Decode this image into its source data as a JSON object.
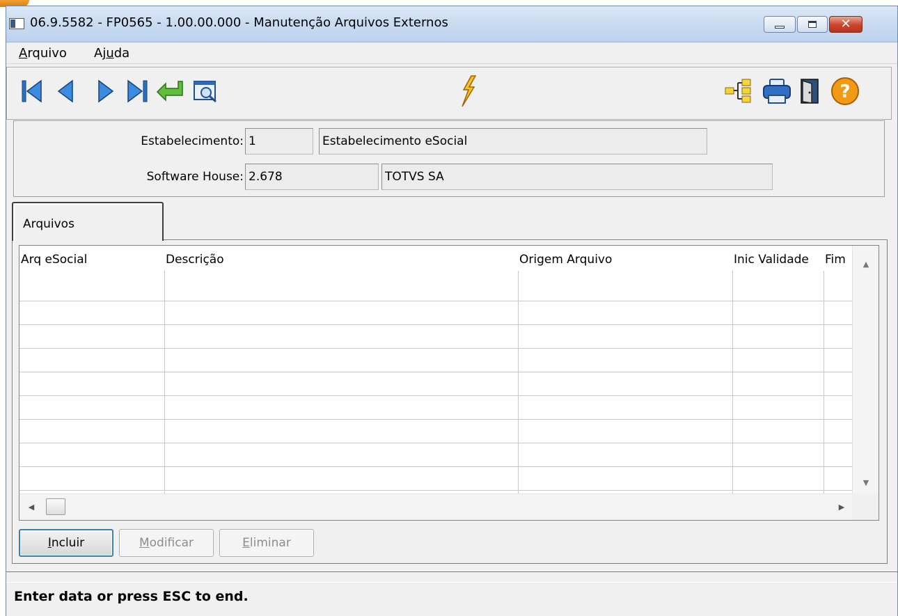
{
  "window": {
    "title": "06.9.5582 - FP0565 - 1.00.00.000 - Manutenção Arquivos Externos",
    "minimize_icon": "minimize-icon",
    "maximize_icon": "maximize-icon",
    "close_icon": "close-icon"
  },
  "menu": {
    "items": [
      {
        "label": "Arquivo",
        "accesskey": "A"
      },
      {
        "label": "Ajuda",
        "accesskey": "u"
      }
    ]
  },
  "toolbar": {
    "left_icons": [
      "first-record-icon",
      "previous-record-icon",
      "next-record-icon",
      "last-record-icon",
      "go-to-icon",
      "search-icon"
    ],
    "center_icon": "lightning-icon",
    "right_icons": [
      "tree-icon",
      "print-icon",
      "exit-door-icon",
      "help-icon"
    ]
  },
  "header": {
    "estabelecimento": {
      "label": "Estabelecimento:",
      "code": "1",
      "name": "Estabelecimento eSocial"
    },
    "software_house": {
      "label": "Software House:",
      "code": "2.678",
      "name": "TOTVS SA"
    }
  },
  "tabs": [
    {
      "label": "Arquivos",
      "active": true
    }
  ],
  "grid": {
    "columns": [
      "Arq eSocial",
      "Descrição",
      "Origem Arquivo",
      "Inic Validade",
      "Fim"
    ],
    "rows": []
  },
  "buttons": {
    "incluir": {
      "label": "Incluir",
      "accesskey": "I",
      "enabled": true
    },
    "modificar": {
      "label": "Modificar",
      "accesskey": "M",
      "enabled": false
    },
    "eliminar": {
      "label": "Eliminar",
      "accesskey": "E",
      "enabled": false
    }
  },
  "status": {
    "message": "Enter data or press ESC to end."
  }
}
